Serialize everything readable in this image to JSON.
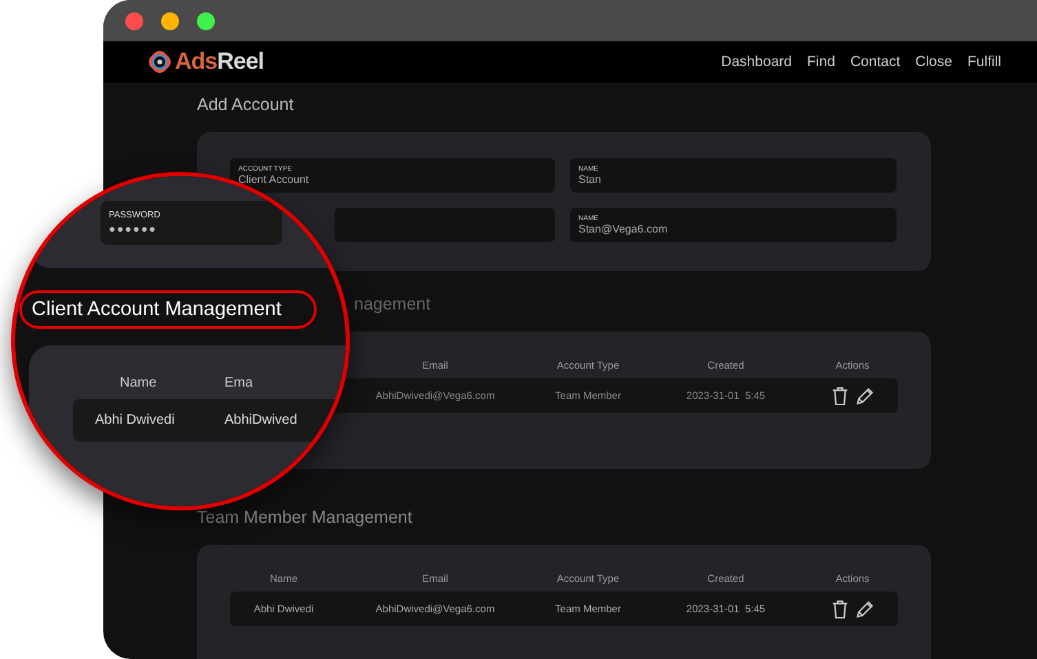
{
  "nav": {
    "logo": {
      "primary": "Ads",
      "secondary": "Reel"
    },
    "links": [
      "Dashboard",
      "Find",
      "Contact",
      "Close",
      "Fulfill"
    ]
  },
  "add_account": {
    "title": "Add Account",
    "fields": [
      {
        "kind": "text",
        "label": "ACCOUNT TYPE",
        "value": "Client Account"
      },
      {
        "kind": "text",
        "label": "NAME",
        "value": "Stan"
      },
      {
        "kind": "blank"
      },
      {
        "kind": "text",
        "label": "NAME",
        "value": "Stan@Vega6.com"
      }
    ]
  },
  "client_accounts": {
    "title_visible": "nagement",
    "columns": [
      "Email",
      "Account Type",
      "Created",
      "Actions"
    ],
    "rows": [
      {
        "cells": [
          "AbhiDwivedi@Vega6.com",
          "Team Member",
          "2023-31-01  5:45"
        ]
      }
    ]
  },
  "team_members": {
    "title": "Team Member Management",
    "columns": [
      "Name",
      "Email",
      "Account Type",
      "Created",
      "Actions"
    ],
    "rows": [
      {
        "cells": [
          "Abhi Dwivedi",
          "AbhiDwivedi@Vega6.com",
          "Team Member",
          "2023-31-01  5:45"
        ]
      }
    ]
  },
  "magnifier": {
    "field": {
      "label": "PASSWORD",
      "value": "●●●●●●"
    },
    "heading": "Client Account Management",
    "columns": [
      "Name",
      "Ema"
    ],
    "rows": [
      {
        "cells": [
          "Abhi Dwivedi",
          "AbhiDwived"
        ]
      }
    ]
  }
}
